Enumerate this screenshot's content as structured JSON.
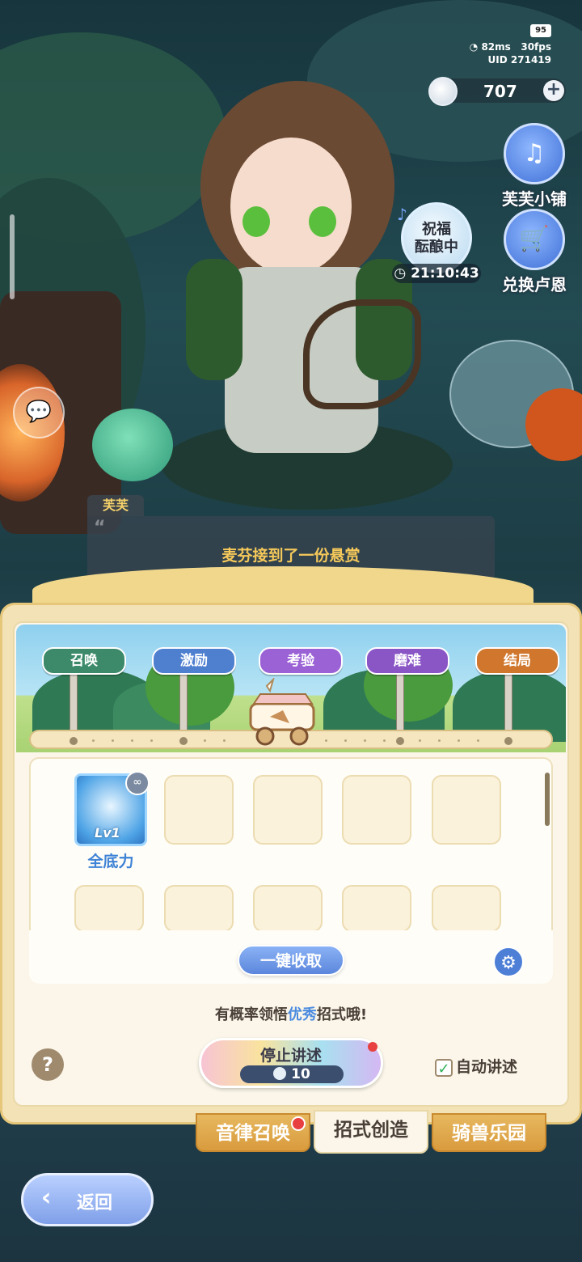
{
  "hud": {
    "battery": "95",
    "ping": "82ms",
    "fps": "30fps",
    "uid": "UID 271419"
  },
  "currency": {
    "value": "707",
    "plus": "+"
  },
  "side_buttons": [
    {
      "label": "芙芙小铺",
      "icon": "harp-icon"
    },
    {
      "label": "兑换卢恩",
      "icon": "shop-cart-icon"
    }
  ],
  "blessing": {
    "line1": "祝福",
    "line2": "酝酿中",
    "timer": "21:10:43"
  },
  "dialogue": {
    "speaker": "芙芙",
    "text": "麦芬接到了一份悬赏"
  },
  "stages": [
    "召唤",
    "激励",
    "考验",
    "磨难",
    "结局"
  ],
  "stage_colors": [
    "#3c8a6a",
    "#4f7fcf",
    "#9b62d6",
    "#8a56c6",
    "#d0772d"
  ],
  "skills": [
    {
      "name": "全底力",
      "level": "Lv1"
    }
  ],
  "buttons": {
    "collect": "一键收取",
    "stop": "停止讲述",
    "stop_cost": "10",
    "help": "?",
    "back": "返回"
  },
  "hint": {
    "prefix": "有概率领悟",
    "highlight": "优秀",
    "suffix": "招式哦!"
  },
  "auto_narrate": {
    "label": "自动讲述",
    "checked": true
  },
  "tabs": [
    {
      "label": "音律召唤",
      "active": false,
      "badge": true
    },
    {
      "label": "招式创造",
      "active": true,
      "badge": false
    },
    {
      "label": "骑兽乐园",
      "active": false,
      "badge": false
    }
  ]
}
